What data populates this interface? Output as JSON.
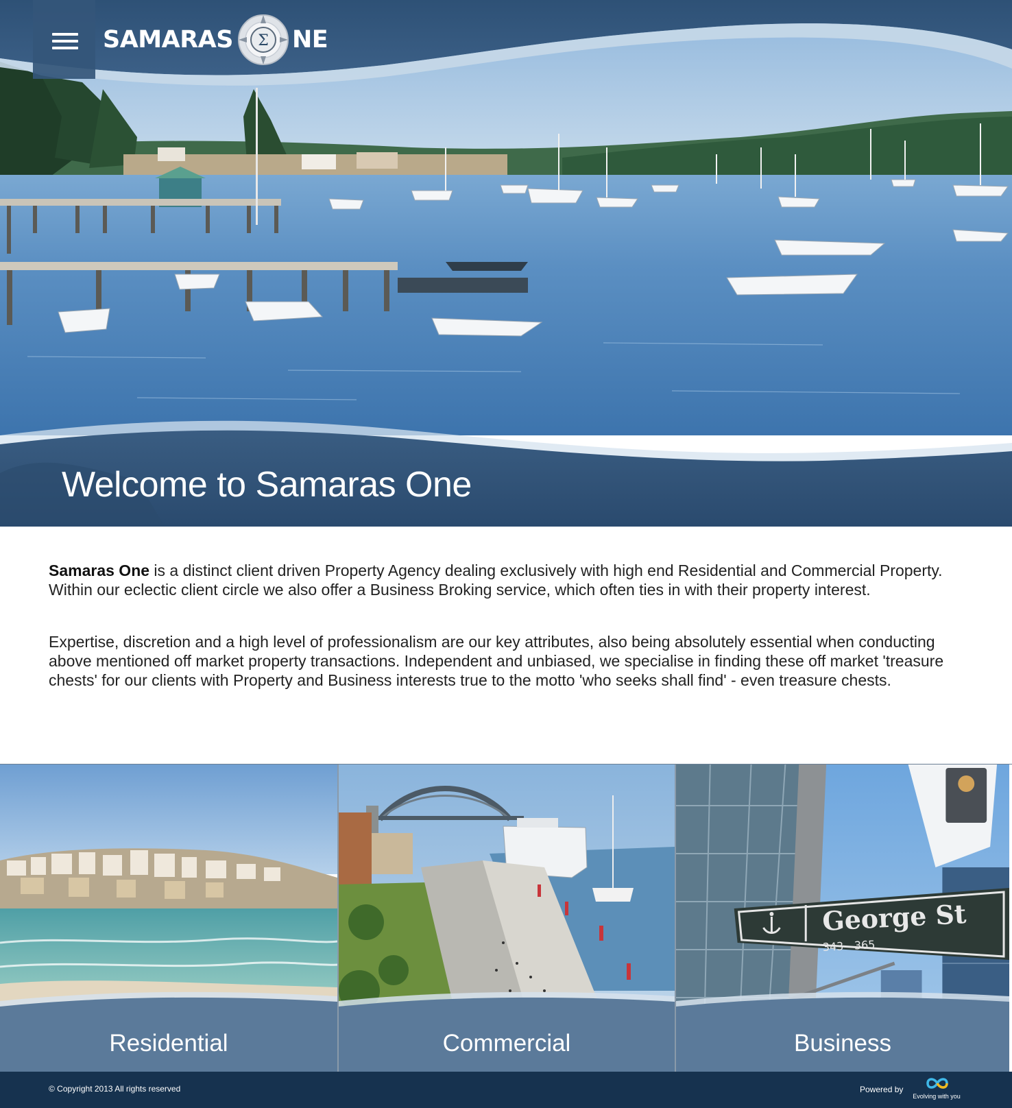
{
  "header": {
    "menu_icon": "hamburger-menu-icon",
    "logo_left": "SAMARAS",
    "logo_right": "NE",
    "logo_emblem_icon": "sigma-compass-icon",
    "logo_emblem_char": "Σ"
  },
  "hero": {
    "image": "harbour-with-boats-and-jetty-photo",
    "welcome": "Welcome to Samaras One"
  },
  "intro": {
    "p1_bold": "Samaras One",
    "p1_rest": " is a distinct client driven Property Agency dealing exclusively with high end Residential and Commercial Property. Within our eclectic client circle we also offer a Business Broking service, which often ties in with their property interest.",
    "p2": "Expertise, discretion and a high level of professionalism are our key attributes, also being absolutely essential when conducting above mentioned off market property transactions. Independent and unbiased, we specialise in finding these off market 'treasure chests' for our clients with Property and Business interests true to the motto 'who seeks shall find' - even treasure chests."
  },
  "tiles": [
    {
      "label": "Residential",
      "image": "beach-and-houses-photo"
    },
    {
      "label": "Commercial",
      "image": "harbour-bridge-and-cruise-ship-photo"
    },
    {
      "label": "Business",
      "image": "george-st-sign-photo",
      "sign_text": "George St",
      "sign_numbers": "343 - 365"
    }
  ],
  "colors": {
    "header_blue": "#34567a",
    "footer_navy": "#16324f",
    "water": "#4e86bd"
  },
  "footer": {
    "copyright": "© Copyright 2013 All rights reserved",
    "powered_by": "Powered by",
    "brand_icon": "infinity-loop-logo-icon",
    "brand_tagline": "Evolving with you"
  }
}
